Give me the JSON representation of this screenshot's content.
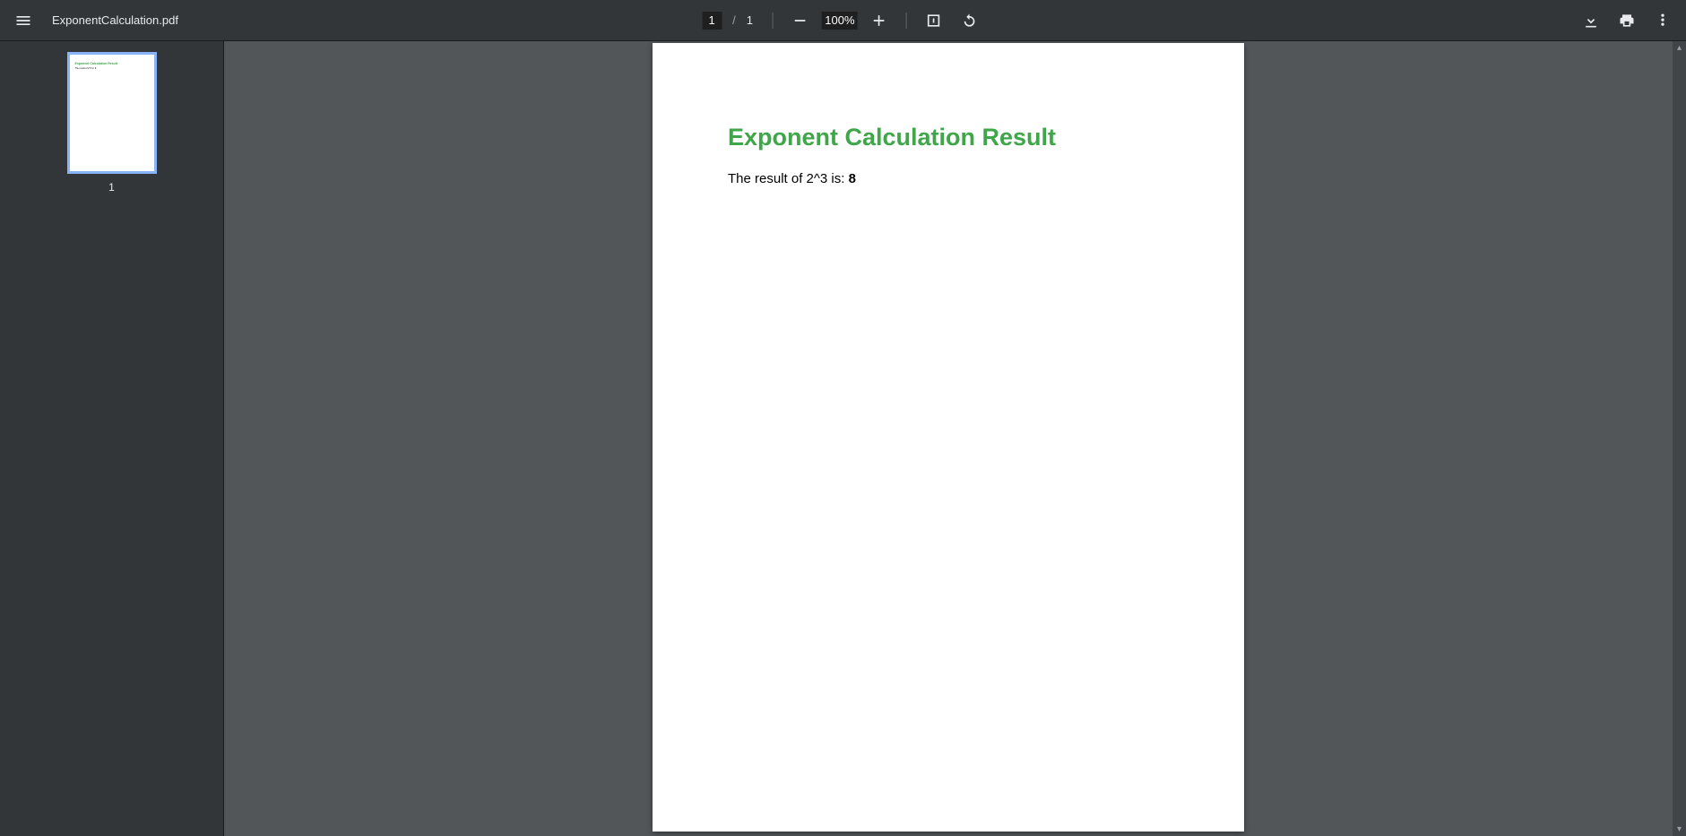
{
  "header": {
    "filename": "ExponentCalculation.pdf",
    "current_page": "1",
    "page_separator": "/",
    "total_pages": "1",
    "zoom": "100%"
  },
  "sidebar": {
    "thumbnails": [
      {
        "number": "1",
        "mini_title": "Exponent Calculation Result",
        "mini_line": "The result of 2^3 is: 8"
      }
    ]
  },
  "document": {
    "title": "Exponent Calculation Result",
    "body_prefix": "The result of 2^3 is: ",
    "body_value": "8"
  }
}
